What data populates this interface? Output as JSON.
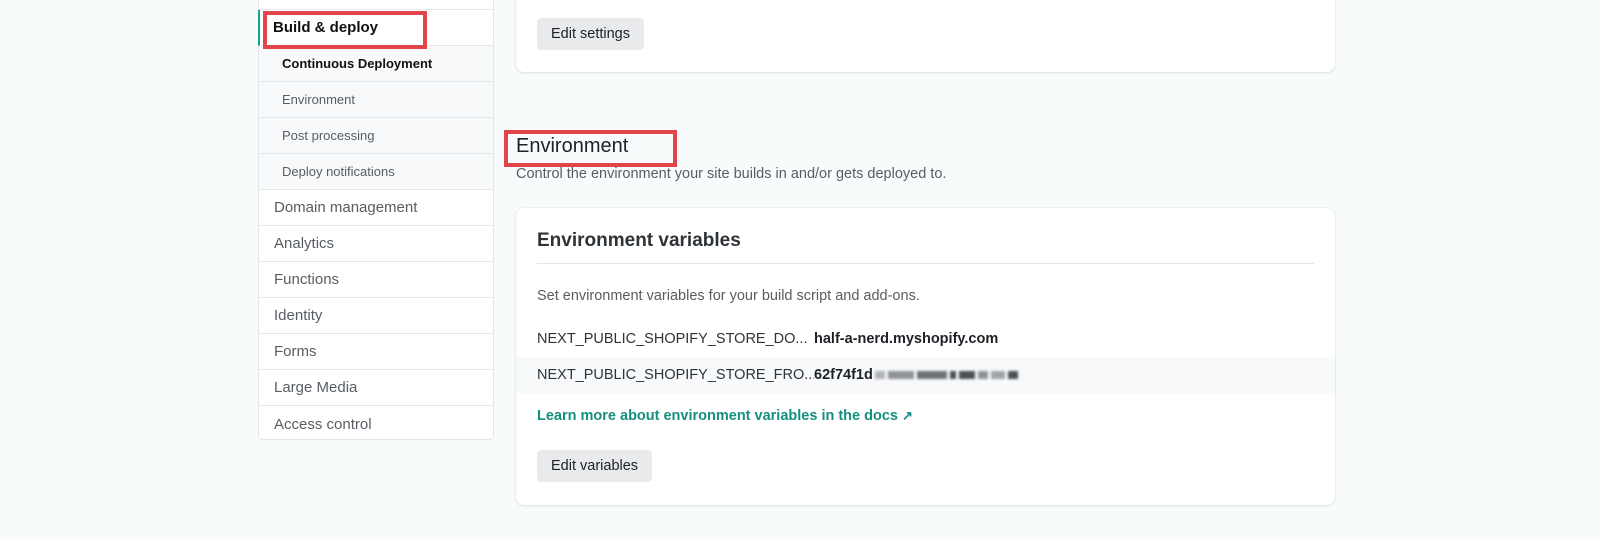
{
  "sidebar": {
    "active_section": "Build & deploy",
    "sub_items": [
      "Continuous Deployment",
      "Environment",
      "Post processing",
      "Deploy notifications"
    ],
    "items": [
      "Domain management",
      "Analytics",
      "Functions",
      "Identity",
      "Forms",
      "Large Media",
      "Access control"
    ]
  },
  "top_card": {
    "button_label": "Edit settings"
  },
  "environment": {
    "title": "Environment",
    "description": "Control the environment your site builds in and/or gets deployed to.",
    "card": {
      "title": "Environment variables",
      "description": "Set environment variables for your build script and add-ons.",
      "variables": [
        {
          "key": "NEXT_PUBLIC_SHOPIFY_STORE_DO...",
          "value": "half-a-nerd.myshopify.com"
        },
        {
          "key": "NEXT_PUBLIC_SHOPIFY_STORE_FRO...",
          "value": "62f74f1d"
        }
      ],
      "docs_link": "Learn more about environment variables in the docs",
      "docs_link_icon": "↗",
      "button_label": "Edit variables"
    }
  },
  "colors": {
    "accent": "#14a190",
    "link": "#158f80",
    "highlight": "#e0454a",
    "background": "#f7fbfb"
  }
}
